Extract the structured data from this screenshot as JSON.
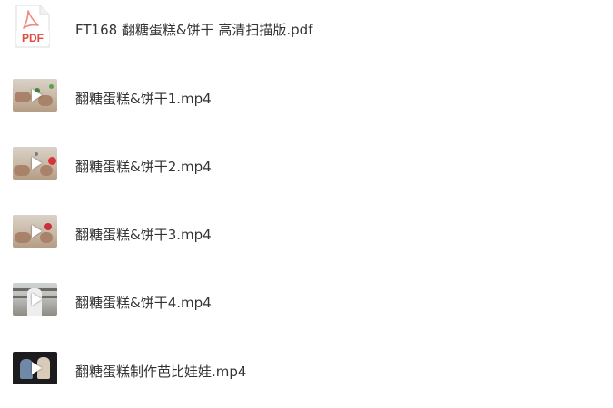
{
  "files": [
    {
      "name": "FT168 翻糖蛋糕&饼干 高清扫描版.pdf",
      "icon": "pdf-file-icon",
      "pdf_badge": "PDF",
      "accent": "#e04a3f"
    },
    {
      "name": "翻糖蛋糕&饼干1.mp4",
      "icon": "video-thumbnail-icon"
    },
    {
      "name": "翻糖蛋糕&饼干2.mp4",
      "icon": "video-thumbnail-icon"
    },
    {
      "name": "翻糖蛋糕&饼干3.mp4",
      "icon": "video-thumbnail-icon"
    },
    {
      "name": "翻糖蛋糕&饼干4.mp4",
      "icon": "video-thumbnail-icon"
    },
    {
      "name": "翻糖蛋糕制作芭比娃娃.mp4",
      "icon": "video-thumbnail-icon"
    }
  ]
}
